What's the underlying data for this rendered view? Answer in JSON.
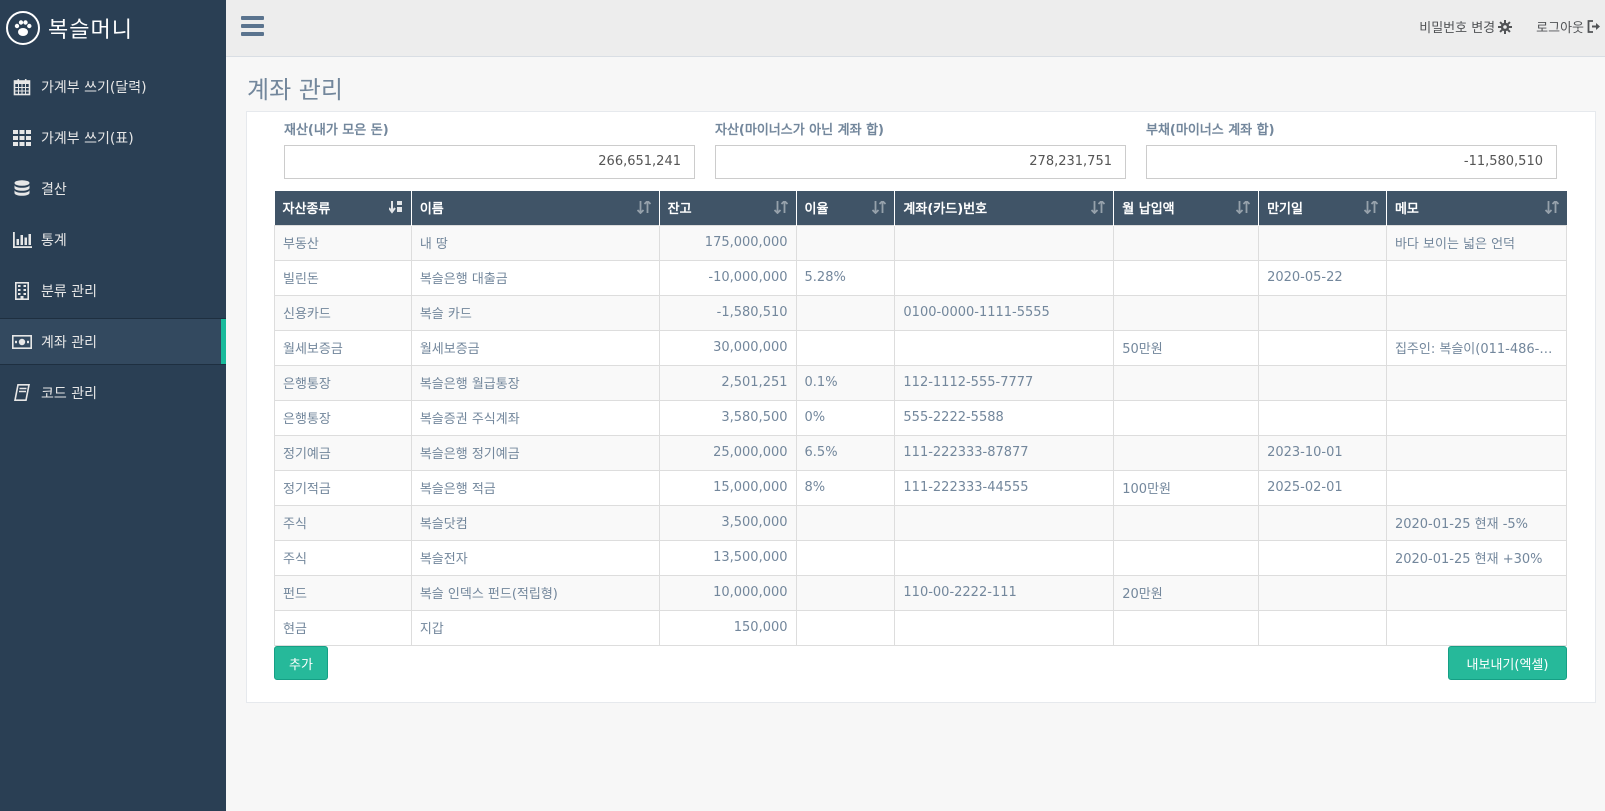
{
  "app": {
    "title": "복슬머니"
  },
  "sidebar": {
    "items": [
      {
        "label": "가계부 쓰기(달력)",
        "icon": "calendar-icon"
      },
      {
        "label": "가계부 쓰기(표)",
        "icon": "table-icon"
      },
      {
        "label": "결산",
        "icon": "database-icon"
      },
      {
        "label": "통계",
        "icon": "bar-chart-icon"
      },
      {
        "label": "분류 관리",
        "icon": "building-icon"
      },
      {
        "label": "계좌 관리",
        "icon": "money-icon",
        "active": true
      },
      {
        "label": "코드 관리",
        "icon": "book-icon"
      }
    ]
  },
  "topbar": {
    "change_password": "비밀번호 변경",
    "logout": "로그아웃"
  },
  "page": {
    "title": "계좌 관리"
  },
  "summary": [
    {
      "label": "재산(내가 모은 돈)",
      "value": "266,651,241"
    },
    {
      "label": "자산(마이너스가 아닌 계좌 합)",
      "value": "278,231,751"
    },
    {
      "label": "부채(마이너스 계좌 합)",
      "value": "-11,580,510"
    }
  ],
  "table": {
    "headers": [
      "자산종류",
      "이름",
      "잔고",
      "이율",
      "계좌(카드)번호",
      "월 납입액",
      "만기일",
      "메모"
    ],
    "rows": [
      [
        "부동산",
        "내 땅",
        "175,000,000",
        "",
        "",
        "",
        "",
        "바다 보이는 넓은 언덕"
      ],
      [
        "빌린돈",
        "복슬은행 대출금",
        "-10,000,000",
        "5.28%",
        "",
        "",
        "2020-05-22",
        ""
      ],
      [
        "신용카드",
        "복슬 카드",
        "-1,580,510",
        "",
        "0100-0000-1111-5555",
        "",
        "",
        ""
      ],
      [
        "월세보증금",
        "월세보증금",
        "30,000,000",
        "",
        "",
        "50만원",
        "",
        "집주인: 복슬이(011-486-0..."
      ],
      [
        "은행통장",
        "복슬은행 월급통장",
        "2,501,251",
        "0.1%",
        "112-1112-555-7777",
        "",
        "",
        ""
      ],
      [
        "은행통장",
        "복슬증권 주식계좌",
        "3,580,500",
        "0%",
        "555-2222-5588",
        "",
        "",
        ""
      ],
      [
        "정기예금",
        "복슬은행 정기예금",
        "25,000,000",
        "6.5%",
        "111-222333-87877",
        "",
        "2023-10-01",
        ""
      ],
      [
        "정기적금",
        "복슬은행 적금",
        "15,000,000",
        "8%",
        "111-222333-44555",
        "100만원",
        "2025-02-01",
        ""
      ],
      [
        "주식",
        "복슬닷컴",
        "3,500,000",
        "",
        "",
        "",
        "",
        "2020-01-25 현재 -5%"
      ],
      [
        "주식",
        "복슬전자",
        "13,500,000",
        "",
        "",
        "",
        "",
        "2020-01-25 현재 +30%"
      ],
      [
        "펀드",
        "복슬 인덱스 펀드(적립형)",
        "10,000,000",
        "",
        "110-00-2222-111",
        "20만원",
        "",
        ""
      ],
      [
        "현금",
        "지갑",
        "150,000",
        "",
        "",
        "",
        "",
        ""
      ]
    ]
  },
  "buttons": {
    "add": "추가",
    "export": "내보내기(엑셀)"
  },
  "colors": {
    "sidebar": "#2a3f54",
    "accent": "#1abb9c",
    "table_header": "#405467",
    "button": "#26b99a"
  }
}
